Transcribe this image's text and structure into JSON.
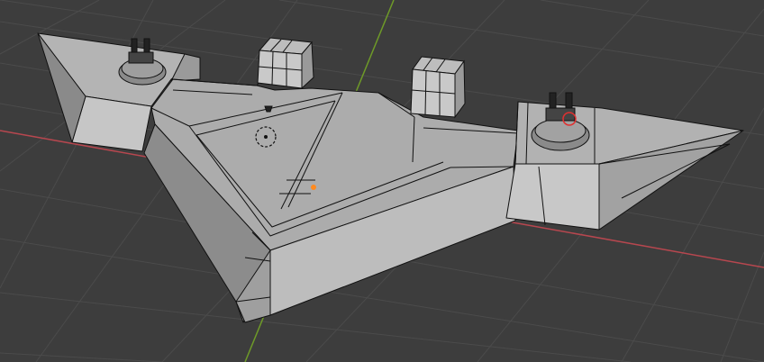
{
  "viewport": {
    "mode": "3d-viewport",
    "background_color": "#3d3d3d",
    "grid_color": "#4a4a4a",
    "x_axis_color": "#b7474f",
    "y_axis_color": "#6e9a28",
    "mesh_face_color": "#a8a8a8",
    "wire_color": "#111111",
    "selection_color": "#e03030",
    "origin_color": "#ff8a1f"
  },
  "scene": {
    "objects": [
      {
        "id": "fortress-base",
        "icon": "mesh-object"
      },
      {
        "id": "tower-block-left",
        "icon": "mesh-object"
      },
      {
        "id": "tower-block-right",
        "icon": "mesh-object"
      },
      {
        "id": "turret-left",
        "icon": "turret-object"
      },
      {
        "id": "turret-right",
        "icon": "turret-object",
        "selected": true
      }
    ],
    "empty": {
      "icon": "empty-object-circle"
    },
    "light": {
      "icon": "light-object"
    },
    "origin": {
      "icon": "object-origin-dot"
    }
  }
}
